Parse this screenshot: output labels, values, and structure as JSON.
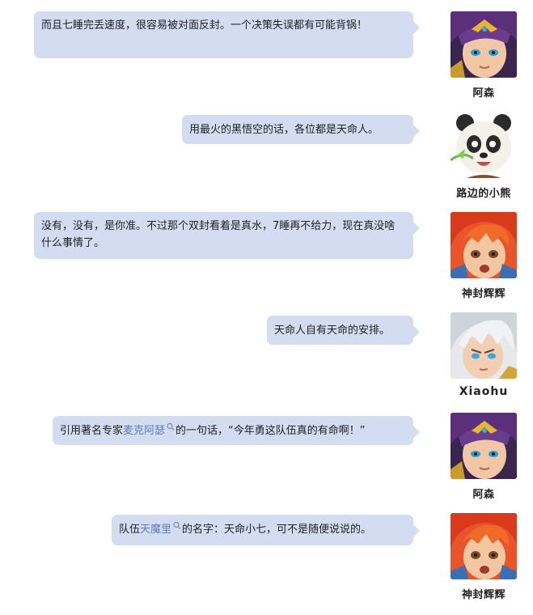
{
  "messages": [
    {
      "user": "阿森",
      "avatar": "purple-haired-hero-avatar",
      "segments": [
        {
          "text": "而且七睡完丢速度，很容易被对面反封。一个决策失误都有可能背锅！"
        }
      ]
    },
    {
      "user": "路边的小熊",
      "avatar": "panda-avatar",
      "segments": [
        {
          "text": "用最火的黑悟空的话，各位都是天命人。"
        }
      ]
    },
    {
      "user": "神封辉辉",
      "avatar": "red-haired-hero-avatar",
      "segments": [
        {
          "text": "没有，没有，是你准。不过那个双封看着是真水，7睡再不给力，现在真没啥什么事情了。"
        }
      ]
    },
    {
      "user": "Xiaohu",
      "avatar": "white-haired-hero-avatar",
      "segments": [
        {
          "text": "天命人自有天命的安排。"
        }
      ]
    },
    {
      "user": "阿森",
      "avatar": "purple-haired-hero-avatar",
      "segments": [
        {
          "text": "引用著名专家"
        },
        {
          "text": "麦克阿瑟",
          "link": true
        },
        {
          "text": "的一句话，“今年勇这队伍真的有命啊！”"
        }
      ]
    },
    {
      "user": "神封辉辉",
      "avatar": "red-haired-hero-avatar",
      "segments": [
        {
          "text": "队伍"
        },
        {
          "text": "天魔里",
          "link": true
        },
        {
          "text": "的名字：天命小七，可不是随便说说的。"
        }
      ]
    }
  ],
  "colors": {
    "bubble": "#d3dcf1",
    "link": "#5a7fb8",
    "text": "#222222"
  }
}
